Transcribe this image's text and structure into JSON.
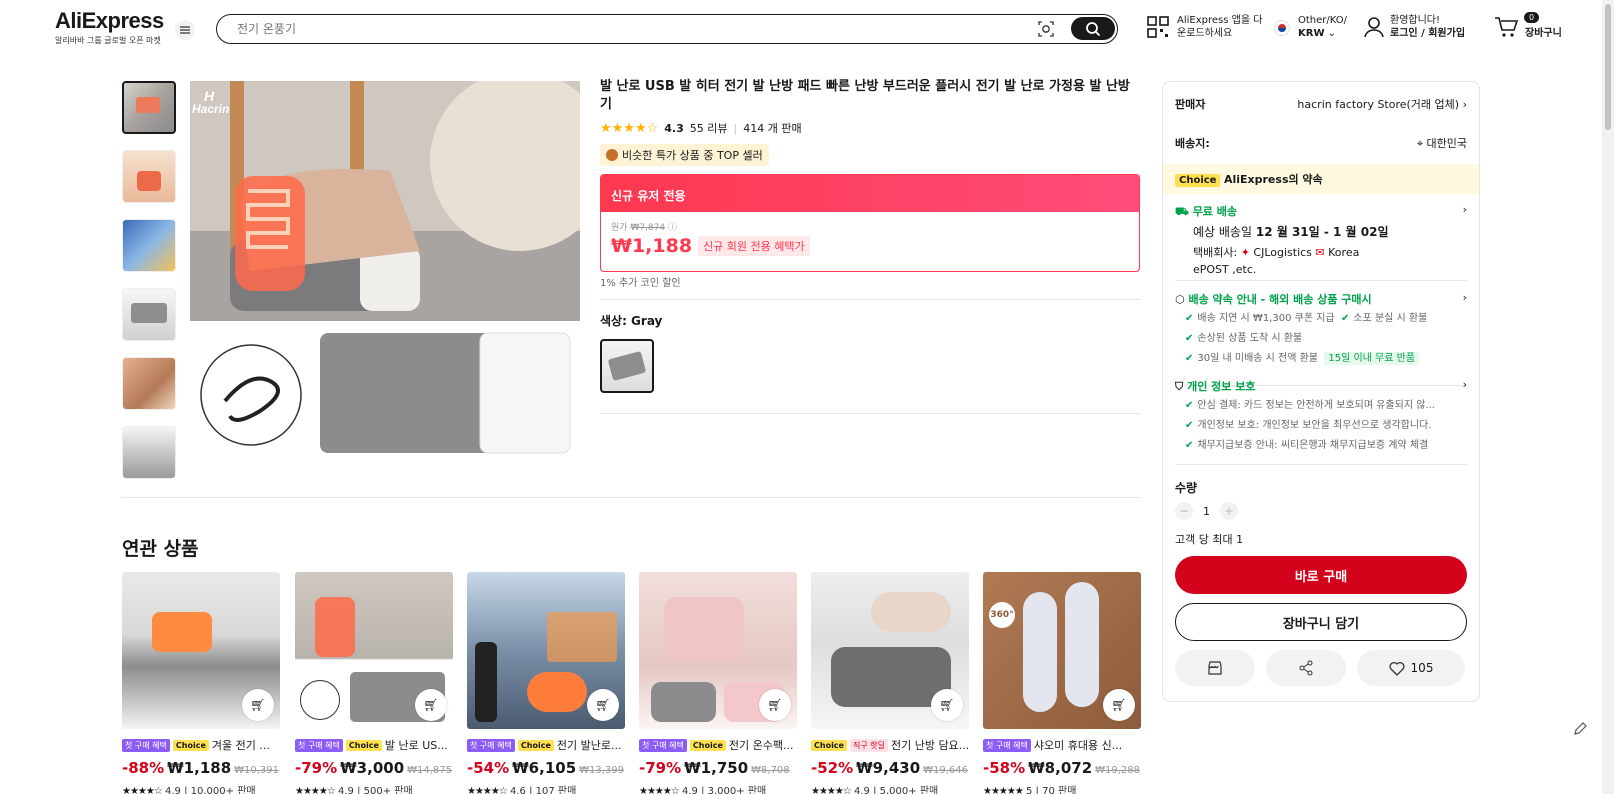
{
  "header": {
    "brand": "AliExpress",
    "tagline": "알리바바 그룹 글로벌 오픈 마켓",
    "search_placeholder": "전기 온풍기",
    "app_line1": "AliExpress 앱을 다",
    "app_line2": "운로드하세요",
    "locale_line1": "Other/KO/",
    "locale_line2": "KRW",
    "account_line1": "환영합니다!",
    "account_line2": "로그인 / 회원가입",
    "cart_count": "0",
    "cart_label": "장바구니"
  },
  "product": {
    "title": "발 난로 USB 발 히터 전기 발 난방 패드 빠른 난방 부드러운 플러시 전기 발 난로 가정용 발 난방기",
    "rating": "4.3",
    "reviews": "55 리뷰",
    "sold": "414 개 판매",
    "top_seller": "비슷한 특가 상품 중 TOP 셀러",
    "promo_head": "신규 유저 전용",
    "orig_label": "원가",
    "orig_price": "₩7,874",
    "price": "₩1,188",
    "benefit": "신규 회원 전용 혜택가",
    "coin": "1% 추가 코인 할인",
    "color_label": "색상: Gray"
  },
  "side": {
    "seller_label": "판매자",
    "seller_value": "hacrin factory Store(거래 업체)",
    "ship_label": "배송지:",
    "ship_value": "대한민국",
    "choice_badge": "Choice",
    "choice_promise": "AliExpress의 약속",
    "free_ship": "무료 배송",
    "eta_prefix": "예상 배송일",
    "eta_value": "12 월 31일 - 1 월 02일",
    "carrier_prefix": "택배회사:",
    "carrier1": "CJLogistics",
    "carrier2": "Korea",
    "carrier3": "ePOST ,etc.",
    "promise_title": "배송 약속 안내 - 해외 배송 상품 구매시",
    "promise_items": [
      "배송 지연 시 ₩1,300 쿠폰 지급",
      "소포 분실 시 환불",
      "손상된 상품 도착 시 환불",
      "30일 내 미배송 시 전액 환불"
    ],
    "free_return": "15일 이내 무료 반품",
    "privacy_title": "개인 정보 보호",
    "privacy_items": [
      "안심 결제: 카드 정보는 안전하게 보호되며 유출되지 않...",
      "개인정보 보호: 개인정보 보안을 최우선으로 생각합니다.",
      "채무지급보증 안내: 씨티은행과 채무지급보증 계약 체결"
    ],
    "qty_label": "수량",
    "qty_value": "1",
    "max_label": "고객 당 최대 1",
    "buy_now": "바로 구매",
    "add_cart": "장바구니 담기",
    "wish_count": "105"
  },
  "related": {
    "title": "연관 상품",
    "cards": [
      {
        "tags": [
          "첫 구매 혜택",
          "Choice"
        ],
        "name": "겨울 전기 ...",
        "disc": "-88%",
        "price": "₩1,188",
        "orig": "₩10,391",
        "stars": "★★★★☆",
        "rate": "4.9 | 10,000+ 판매"
      },
      {
        "tags": [
          "첫 구매 혜택",
          "Choice"
        ],
        "name": "발 난로 US...",
        "disc": "-79%",
        "price": "₩3,000",
        "orig": "₩14,875",
        "stars": "★★★★☆",
        "rate": "4.9 | 500+ 판매"
      },
      {
        "tags": [
          "첫 구매 혜택",
          "Choice"
        ],
        "name": "전기 발난로...",
        "disc": "-54%",
        "price": "₩6,105",
        "orig": "₩13,399",
        "stars": "★★★★☆",
        "rate": "4.6 | 107 판매"
      },
      {
        "tags": [
          "첫 구매 혜택",
          "Choice"
        ],
        "name": "전기 온수팩...",
        "disc": "-79%",
        "price": "₩1,750",
        "orig": "₩8,708",
        "stars": "★★★★☆",
        "rate": "4.9 | 3,000+ 판매"
      },
      {
        "tags": [
          "Choice",
          "직구 핫딜"
        ],
        "name": "전기 난방 담요...",
        "disc": "-52%",
        "price": "₩9,430",
        "orig": "₩19,646",
        "stars": "★★★★☆",
        "rate": "4.9 | 5,000+ 판매"
      },
      {
        "tags": [
          "첫 구매 혜택"
        ],
        "name": "샤오미 휴대용 신...",
        "disc": "-58%",
        "price": "₩8,072",
        "orig": "₩19,288",
        "stars": "★★★★★",
        "rate": "5 | 70 판매"
      }
    ]
  },
  "colors": {
    "accent": "#fd384f",
    "buy": "#d3031c",
    "choice": "#ffe14f",
    "green": "#00a34a"
  }
}
